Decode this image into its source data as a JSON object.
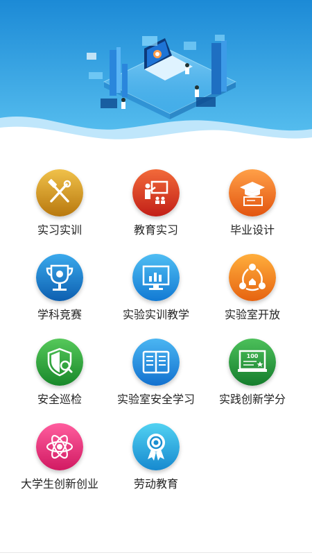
{
  "banner": {
    "illustration": "isometric-computer-lab-illustration",
    "colors": {
      "top": "#1c8ad6",
      "bottom": "#5cc3f1",
      "wave": "#bfe6fb"
    }
  },
  "menu": {
    "items": [
      {
        "label": "实习实训",
        "icon": "hammer-wrench-icon",
        "colors": [
          "#f0c14a",
          "#b8780e"
        ]
      },
      {
        "label": "教育实习",
        "icon": "teacher-board-icon",
        "colors": [
          "#f26a3a",
          "#c21f17"
        ]
      },
      {
        "label": "毕业设计",
        "icon": "graduation-cap-icon",
        "colors": [
          "#ffa048",
          "#e2540f"
        ]
      },
      {
        "label": "学科竞赛",
        "icon": "trophy-icon",
        "colors": [
          "#3aa9ec",
          "#0d5fb0"
        ]
      },
      {
        "label": "实验实训教学",
        "icon": "monitor-chart-icon",
        "colors": [
          "#4fbdf3",
          "#127ad3"
        ]
      },
      {
        "label": "实验室开放",
        "icon": "share-network-icon",
        "colors": [
          "#ffae3c",
          "#e66310"
        ]
      },
      {
        "label": "安全巡检",
        "icon": "shield-search-icon",
        "colors": [
          "#56c85a",
          "#18882a"
        ]
      },
      {
        "label": "实验室安全学习",
        "icon": "open-book-icon",
        "colors": [
          "#4bb6f2",
          "#1271cf"
        ]
      },
      {
        "label": "实践创新学分",
        "icon": "certificate-100-icon",
        "colors": [
          "#4cc05a",
          "#157d2d"
        ]
      },
      {
        "label": "大学生创新创业",
        "icon": "atom-icon",
        "colors": [
          "#ff5d9e",
          "#d11a62"
        ]
      },
      {
        "label": "劳动教育",
        "icon": "medal-ribbon-icon",
        "colors": [
          "#52d2f2",
          "#1689cf"
        ]
      }
    ]
  },
  "certificate_text": "100"
}
